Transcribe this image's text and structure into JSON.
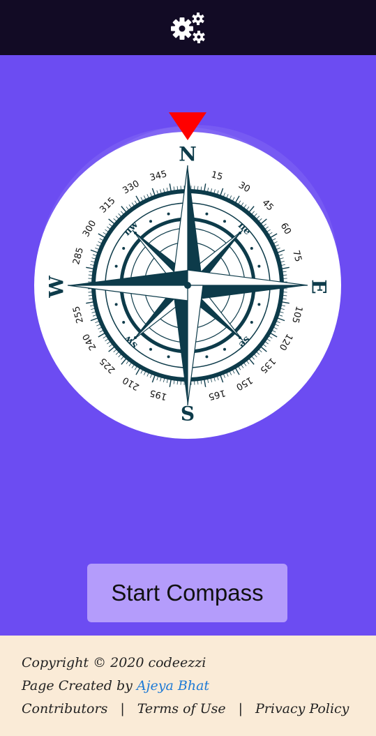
{
  "header": {
    "settings_icon": "gears-icon"
  },
  "compass": {
    "cardinals": {
      "n": "N",
      "e": "E",
      "s": "S",
      "w": "W"
    },
    "intercardinals": {
      "ne": "ne",
      "se": "se",
      "sw": "sw",
      "nw": "nw"
    },
    "degree_labels": [
      "15",
      "30",
      "45",
      "60",
      "75",
      "105",
      "120",
      "135",
      "150",
      "165",
      "195",
      "210",
      "225",
      "240",
      "255",
      "285",
      "300",
      "315",
      "330",
      "345"
    ],
    "needle_color": "#ff0000",
    "ink_color": "#0d3b4a"
  },
  "action": {
    "start_label": "Start Compass"
  },
  "footer": {
    "copyright": "Copyright © 2020 codeezzi",
    "created_prefix": "Page Created by ",
    "author": "Ajeya Bhat",
    "contributors": "Contributors",
    "separator": "|",
    "terms": "Terms of Use",
    "privacy": "Privacy Policy"
  },
  "colors": {
    "topbar": "#120b25",
    "background": "#6c4cf2",
    "button": "#b49cfb",
    "footer": "#faebd7",
    "link": "#1e7ad6"
  }
}
